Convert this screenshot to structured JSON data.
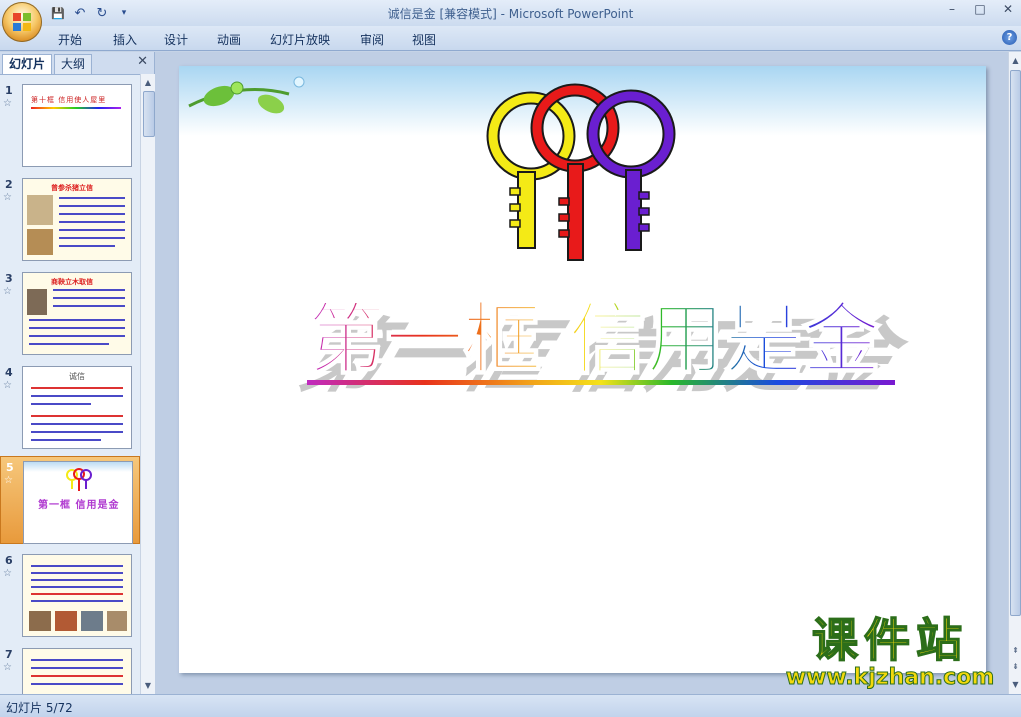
{
  "window": {
    "title": "诚信是金 [兼容模式] - Microsoft PowerPoint",
    "controls": {
      "minimize": "–",
      "maximize": "□",
      "close": "✕"
    }
  },
  "quick_access": {
    "save": "💾",
    "undo": "↶",
    "redo": "↻",
    "more": "▾"
  },
  "ribbon": {
    "tabs": [
      "开始",
      "插入",
      "设计",
      "动画",
      "幻灯片放映",
      "审阅",
      "视图"
    ],
    "help": "?"
  },
  "left_pane": {
    "tabs": [
      "幻灯片",
      "大纲"
    ],
    "close": "✕",
    "thumbnails": [
      {
        "number": "1",
        "caption": "第十框 信用使人屋里"
      },
      {
        "number": "2",
        "caption": "曾参杀猪立信"
      },
      {
        "number": "3",
        "caption": "商鞅立木取信"
      },
      {
        "number": "4",
        "caption": "诚信"
      },
      {
        "number": "5",
        "caption": "第一框 信用是金"
      },
      {
        "number": "6",
        "caption": ""
      },
      {
        "number": "7",
        "caption": ""
      }
    ],
    "selected_index": 4
  },
  "slide": {
    "title": "第一框  信用是金"
  },
  "status_bar": {
    "text": "幻灯片 5/72"
  },
  "watermark": {
    "brand": "课件站",
    "url": "www.kjzhan.com"
  },
  "colors": {
    "selection": "#e89a3c",
    "key_yellow": "#f4ea16",
    "key_red": "#e81a1a",
    "key_purple": "#6a1fd0"
  }
}
